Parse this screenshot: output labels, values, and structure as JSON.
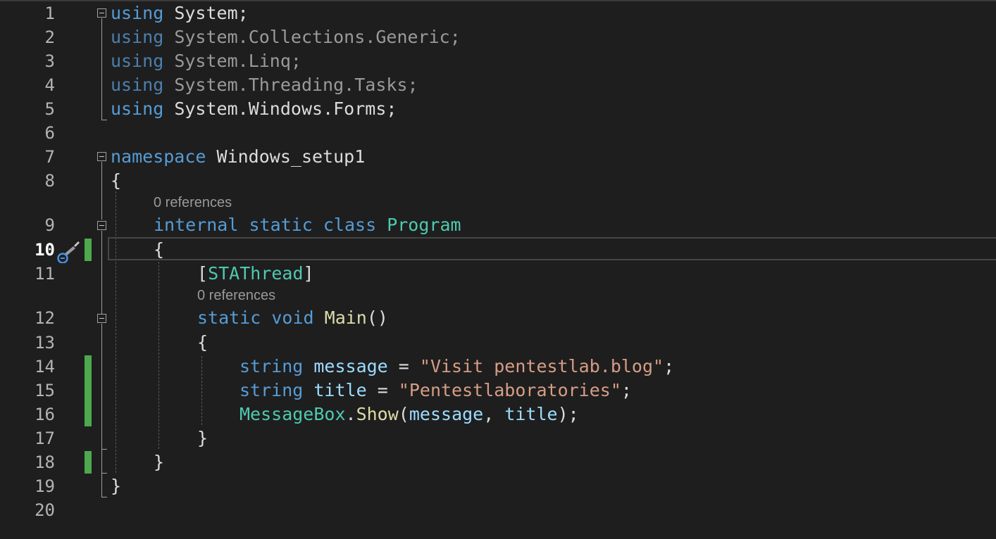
{
  "editor": {
    "current_line": "10",
    "lines": [
      {
        "num": "1"
      },
      {
        "num": "2"
      },
      {
        "num": "3"
      },
      {
        "num": "4"
      },
      {
        "num": "5"
      },
      {
        "num": "6"
      },
      {
        "num": "7"
      },
      {
        "num": "8"
      },
      {
        "num": "9"
      },
      {
        "num": "10"
      },
      {
        "num": "11"
      },
      {
        "num": "12"
      },
      {
        "num": "13"
      },
      {
        "num": "14"
      },
      {
        "num": "15"
      },
      {
        "num": "16"
      },
      {
        "num": "17"
      },
      {
        "num": "18"
      },
      {
        "num": "19"
      },
      {
        "num": "20"
      }
    ],
    "code": {
      "l1": {
        "kw": "using",
        "ns": "System",
        "semi": ";"
      },
      "l2": {
        "kw": "using",
        "p1": "System",
        "d1": ".",
        "p2": "Collections",
        "d2": ".",
        "p3": "Generic",
        "semi": ";"
      },
      "l3": {
        "kw": "using",
        "p1": "System",
        "d1": ".",
        "p2": "Linq",
        "semi": ";"
      },
      "l4": {
        "kw": "using",
        "p1": "System",
        "d1": ".",
        "p2": "Threading",
        "d2": ".",
        "p3": "Tasks",
        "semi": ";"
      },
      "l5": {
        "kw": "using",
        "p1": "System",
        "d1": ".",
        "p2": "Windows",
        "d2": ".",
        "p3": "Forms",
        "semi": ";"
      },
      "l7": {
        "kw": "namespace",
        "name": "Windows_setup1"
      },
      "l8": {
        "brace": "{"
      },
      "refs_class": "0 references",
      "l9": {
        "kw1": "internal",
        "kw2": "static",
        "kw3": "class",
        "name": "Program"
      },
      "l10": {
        "brace": "{"
      },
      "l11": {
        "open": "[",
        "attr": "STAThread",
        "close": "]"
      },
      "refs_main": "0 references",
      "l12": {
        "kw1": "static",
        "kw2": "void",
        "name": "Main",
        "parens": "()"
      },
      "l13": {
        "brace": "{"
      },
      "l14": {
        "type": "string",
        "var": "message",
        "eq": " = ",
        "str": "\"Visit pentestlab.blog\"",
        "semi": ";"
      },
      "l15": {
        "type": "string",
        "var": "title",
        "eq": " = ",
        "str": "\"Pentestlaboratories\"",
        "semi": ";"
      },
      "l16": {
        "cls": "MessageBox",
        "dot": ".",
        "fn": "Show",
        "open": "(",
        "a1": "message",
        "comma": ", ",
        "a2": "title",
        "close": ");"
      },
      "l17": {
        "brace": "}"
      },
      "l18": {
        "brace": "}"
      },
      "l19": {
        "brace": "}"
      }
    },
    "colors": {
      "background": "#1e1e1e",
      "keyword": "#569cd6",
      "type": "#4ec9b0",
      "string": "#d69d85",
      "method": "#dcdcaa",
      "variable": "#9cdcfe",
      "change_bar": "#4ea84e"
    },
    "icons": {
      "quick_actions": "screwdriver-icon",
      "fold": "collapse-minus-icon"
    }
  }
}
